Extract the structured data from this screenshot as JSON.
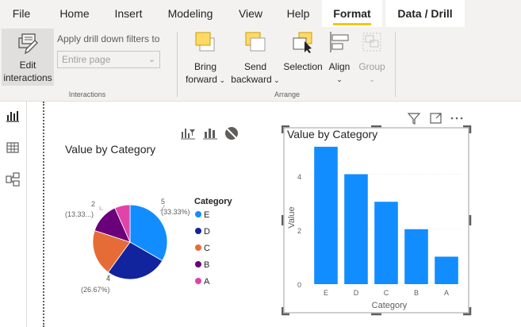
{
  "menu": {
    "tabs": [
      "File",
      "Home",
      "Insert",
      "Modeling",
      "View",
      "Help",
      "Format",
      "Data / Drill"
    ]
  },
  "ribbon": {
    "edit_interactions": [
      "Edit",
      "interactions"
    ],
    "drill_filter_label": "Apply drill down filters to",
    "drill_filter_value": "Entire page",
    "bring_forward": [
      "Bring",
      "forward"
    ],
    "send_backward": [
      "Send",
      "backward"
    ],
    "selection": "Selection",
    "align": "Align",
    "group": "Group",
    "group_interactions": "Interactions",
    "group_arrange": "Arrange"
  },
  "colors": {
    "E": "#118dff",
    "D": "#12239e",
    "C": "#e66c37",
    "B": "#6b007b",
    "A": "#e044a7",
    "bar": "#118dff",
    "accent": "#f2c811"
  },
  "pie": {
    "title": "Value by Category",
    "legend_title": "Category",
    "labels": {
      "top_right": [
        "5",
        "(33.33%)"
      ],
      "top_left": [
        "2",
        "(13.33...)"
      ],
      "bottom": [
        "4",
        "(26.67%)"
      ]
    }
  },
  "bar": {
    "title": "Value by Category",
    "xlabel": "Category",
    "ylabel": "Value",
    "yticks": [
      "0",
      "2",
      "4"
    ]
  },
  "chart_data": [
    {
      "type": "pie",
      "title": "Value by Category",
      "legend_title": "Category",
      "categories": [
        "E",
        "D",
        "C",
        "B",
        "A"
      ],
      "values": [
        5,
        4,
        3,
        2,
        1
      ]
    },
    {
      "type": "bar",
      "title": "Value by Category",
      "xlabel": "Category",
      "ylabel": "Value",
      "categories": [
        "E",
        "D",
        "C",
        "B",
        "A"
      ],
      "values": [
        5,
        4,
        3,
        2,
        1
      ],
      "ylim": [
        0,
        5.2
      ]
    }
  ]
}
